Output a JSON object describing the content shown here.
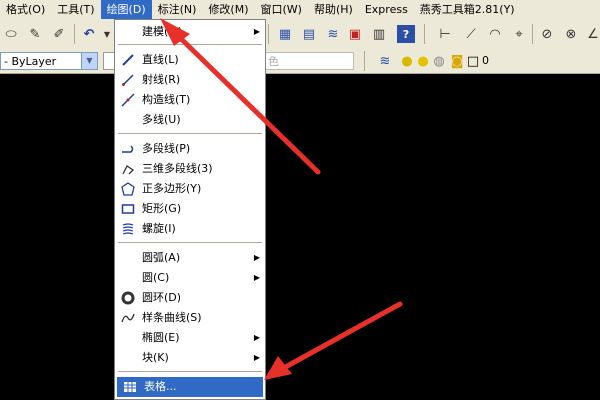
{
  "menubar": {
    "items": [
      {
        "label": "格式(O)"
      },
      {
        "label": "工具(T)"
      },
      {
        "label": "绘图(D)"
      },
      {
        "label": "标注(N)"
      },
      {
        "label": "修改(M)"
      },
      {
        "label": "窗口(W)"
      },
      {
        "label": "帮助(H)"
      },
      {
        "label": "Express"
      },
      {
        "label": "燕秀工具箱2.81(Y)"
      }
    ]
  },
  "properties": {
    "layer_combo": "- ByLayer",
    "color_combo_dim": "色",
    "layer_value": "0"
  },
  "draw_menu": {
    "items": [
      {
        "label": "建模(M)",
        "submenu": true
      },
      {
        "label": "直线(L)"
      },
      {
        "label": "射线(R)"
      },
      {
        "label": "构造线(T)"
      },
      {
        "label": "多线(U)"
      },
      {
        "label": "多段线(P)"
      },
      {
        "label": "三维多段线(3)"
      },
      {
        "label": "正多边形(Y)"
      },
      {
        "label": "矩形(G)"
      },
      {
        "label": "螺旋(I)"
      },
      {
        "label": "圆弧(A)",
        "submenu": true
      },
      {
        "label": "圆(C)",
        "submenu": true
      },
      {
        "label": "圆环(D)"
      },
      {
        "label": "样条曲线(S)"
      },
      {
        "label": "椭圆(E)",
        "submenu": true
      },
      {
        "label": "块(K)",
        "submenu": true
      },
      {
        "label": "表格..."
      }
    ],
    "submenu_glyph": "▶"
  },
  "colors": {
    "menu_highlight": "#316ac5",
    "annotation_arrow": "#e8302a",
    "canvas": "#000000"
  }
}
